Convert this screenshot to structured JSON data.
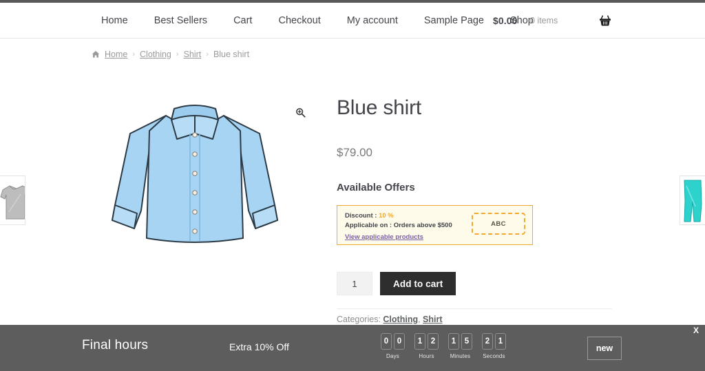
{
  "header": {
    "nav_items": [
      {
        "label": "Home"
      },
      {
        "label": "Best Sellers"
      },
      {
        "label": "Cart"
      },
      {
        "label": "Checkout"
      },
      {
        "label": "My account"
      },
      {
        "label": "Sample Page"
      },
      {
        "label": "Shop"
      }
    ],
    "cart": {
      "amount": "$0.00",
      "count": "0 items",
      "icon": "shopping-basket-icon"
    }
  },
  "breadcrumb": {
    "home_icon": "home-icon",
    "separator": "›",
    "items": [
      {
        "label": "Home",
        "link": true
      },
      {
        "label": "Clothing",
        "link": true
      },
      {
        "label": "Shirt",
        "link": true
      },
      {
        "label": "Blue shirt",
        "link": false
      }
    ]
  },
  "gallery": {
    "zoom_icon": "magnifier-plus-icon",
    "main_image_alt": "blue-dress-shirt",
    "peek_left_alt": "gray-tshirt-thumbnail",
    "peek_right_alt": "teal-pants-thumbnail"
  },
  "product": {
    "title": "Blue shirt",
    "price": "$79.00",
    "offers_heading": "Available Offers",
    "offer": {
      "discount_label": "Discount : ",
      "discount_value": "10 %",
      "applicable_label": "Applicable on : Orders above $500",
      "link_text": "View applicable products",
      "coupon_code": "ABC"
    },
    "quantity": "1",
    "add_to_cart_label": "Add to cart",
    "categories_label": "Categories: ",
    "categories": [
      {
        "label": "Clothing"
      },
      {
        "label": "Shirt"
      }
    ],
    "categories_separator": ", "
  },
  "promo_bar": {
    "headline": "Final hours",
    "subtext": "Extra 10% Off",
    "cta_label": "new",
    "close_label": "X",
    "countdown": [
      {
        "label": "Days",
        "digits": [
          "0",
          "0"
        ]
      },
      {
        "label": "Hours",
        "digits": [
          "1",
          "2"
        ]
      },
      {
        "label": "Minutes",
        "digits": [
          "1",
          "5"
        ]
      },
      {
        "label": "Seconds",
        "digits": [
          "2",
          "1"
        ]
      }
    ]
  },
  "colors": {
    "accent_offer": "#f0a92e",
    "offer_bg": "#fefbea",
    "link_purple": "#7b5ea7",
    "button_dark": "#2e2e2e",
    "promo_bar": "#5d5d5d",
    "shirt_blue": "#a6d4f2"
  }
}
